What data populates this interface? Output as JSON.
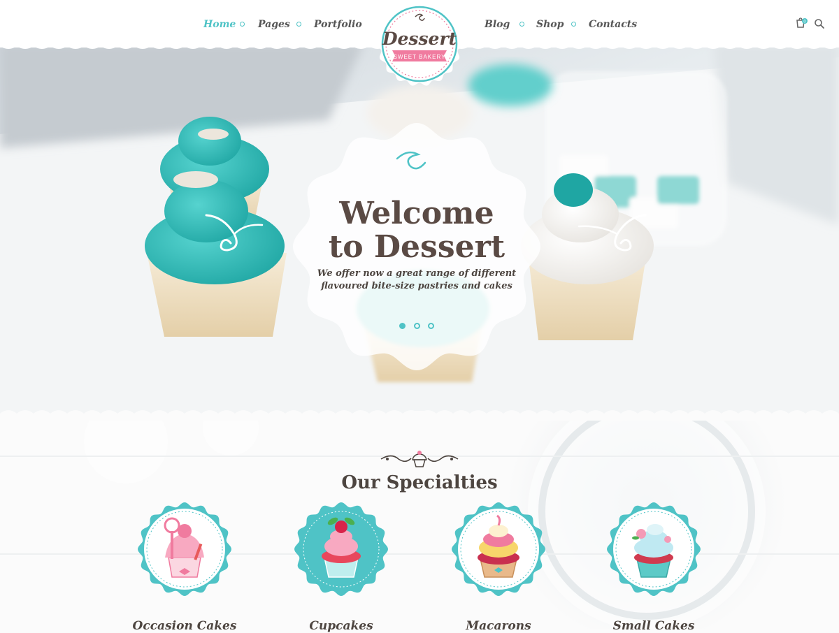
{
  "nav": {
    "left": [
      {
        "label": "Home",
        "active": true
      },
      {
        "label": "Pages",
        "active": false
      },
      {
        "label": "Portfolio",
        "active": false
      }
    ],
    "right": [
      {
        "label": "Blog",
        "active": false
      },
      {
        "label": "Shop",
        "active": false
      },
      {
        "label": "Contacts",
        "active": false
      }
    ],
    "cart_count": "0",
    "icons": [
      "cart-icon",
      "search-icon"
    ]
  },
  "logo": {
    "name": "Dessert",
    "ribbon": "SWEET BAKERY"
  },
  "hero": {
    "title_line1": "Welcome",
    "title_line2": "to Dessert",
    "subtitle_line1": "We offer now a great range of different",
    "subtitle_line2": "flavoured bite-size pastries and cakes",
    "slides": 3,
    "active_slide": 1
  },
  "specialties": {
    "title": "Our Specialties",
    "items": [
      {
        "label": "Occasion Cakes",
        "icon": "occasion-cake-icon"
      },
      {
        "label": "Cupcakes",
        "icon": "cupcake-icon"
      },
      {
        "label": "Macarons",
        "icon": "macaron-icon"
      },
      {
        "label": "Small Cakes",
        "icon": "small-cake-icon"
      }
    ]
  },
  "colors": {
    "accent": "#4fc3c6",
    "text": "#4d4540",
    "pink": "#f07b9f"
  }
}
